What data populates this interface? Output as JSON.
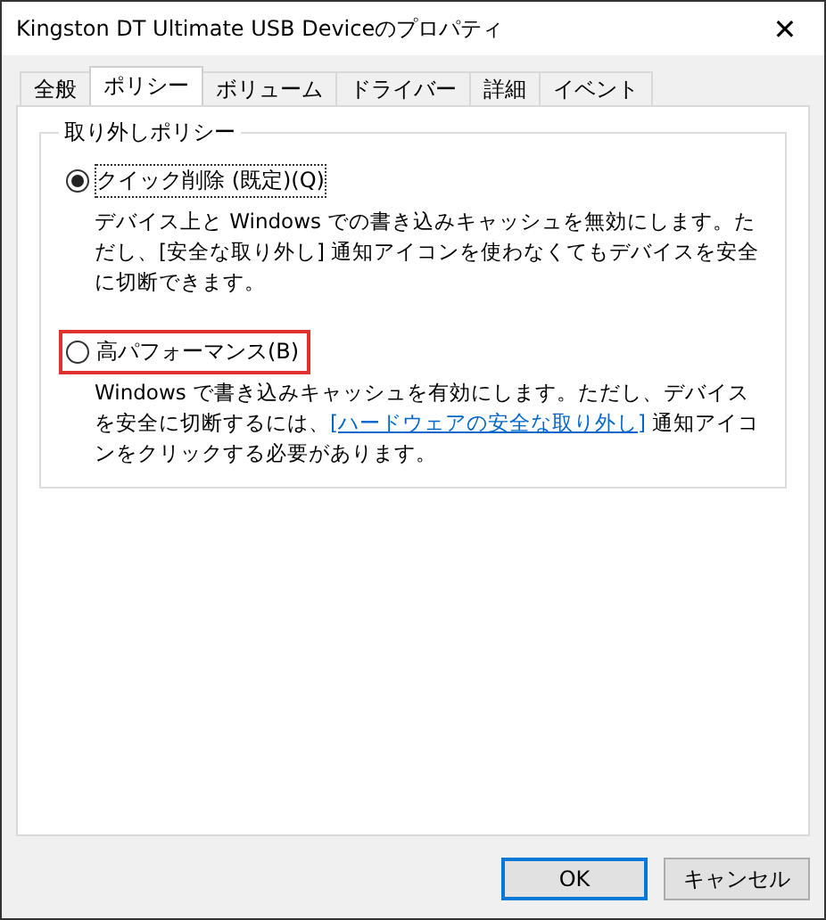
{
  "window": {
    "title": "Kingston DT Ultimate USB Deviceのプロパティ",
    "close": "✕"
  },
  "tabs": [
    {
      "label": "全般",
      "selected": false
    },
    {
      "label": "ポリシー",
      "selected": true
    },
    {
      "label": "ボリューム",
      "selected": false
    },
    {
      "label": "ドライバー",
      "selected": false
    },
    {
      "label": "詳細",
      "selected": false
    },
    {
      "label": "イベント",
      "selected": false
    }
  ],
  "group": {
    "title": "取り外しポリシー",
    "options": [
      {
        "label": "クイック削除 (既定)(Q)",
        "selected": true,
        "highlighted": false,
        "description": {
          "before": "デバイス上と Windows での書き込みキャッシュを無効にします。ただし、[安全な取り外し] 通知アイコンを使わなくてもデバイスを安全に切断できます。"
        }
      },
      {
        "label": "高パフォーマンス(B)",
        "selected": false,
        "highlighted": true,
        "description": {
          "before": "Windows で書き込みキャッシュを有効にします。ただし、デバイスを安全に切断するには、",
          "link": "[ハードウェアの安全な取り外し]",
          "after": " 通知アイコンをクリックする必要があります。"
        }
      }
    ]
  },
  "buttons": [
    {
      "label": "OK",
      "default": true
    },
    {
      "label": "キャンセル",
      "default": false
    }
  ]
}
